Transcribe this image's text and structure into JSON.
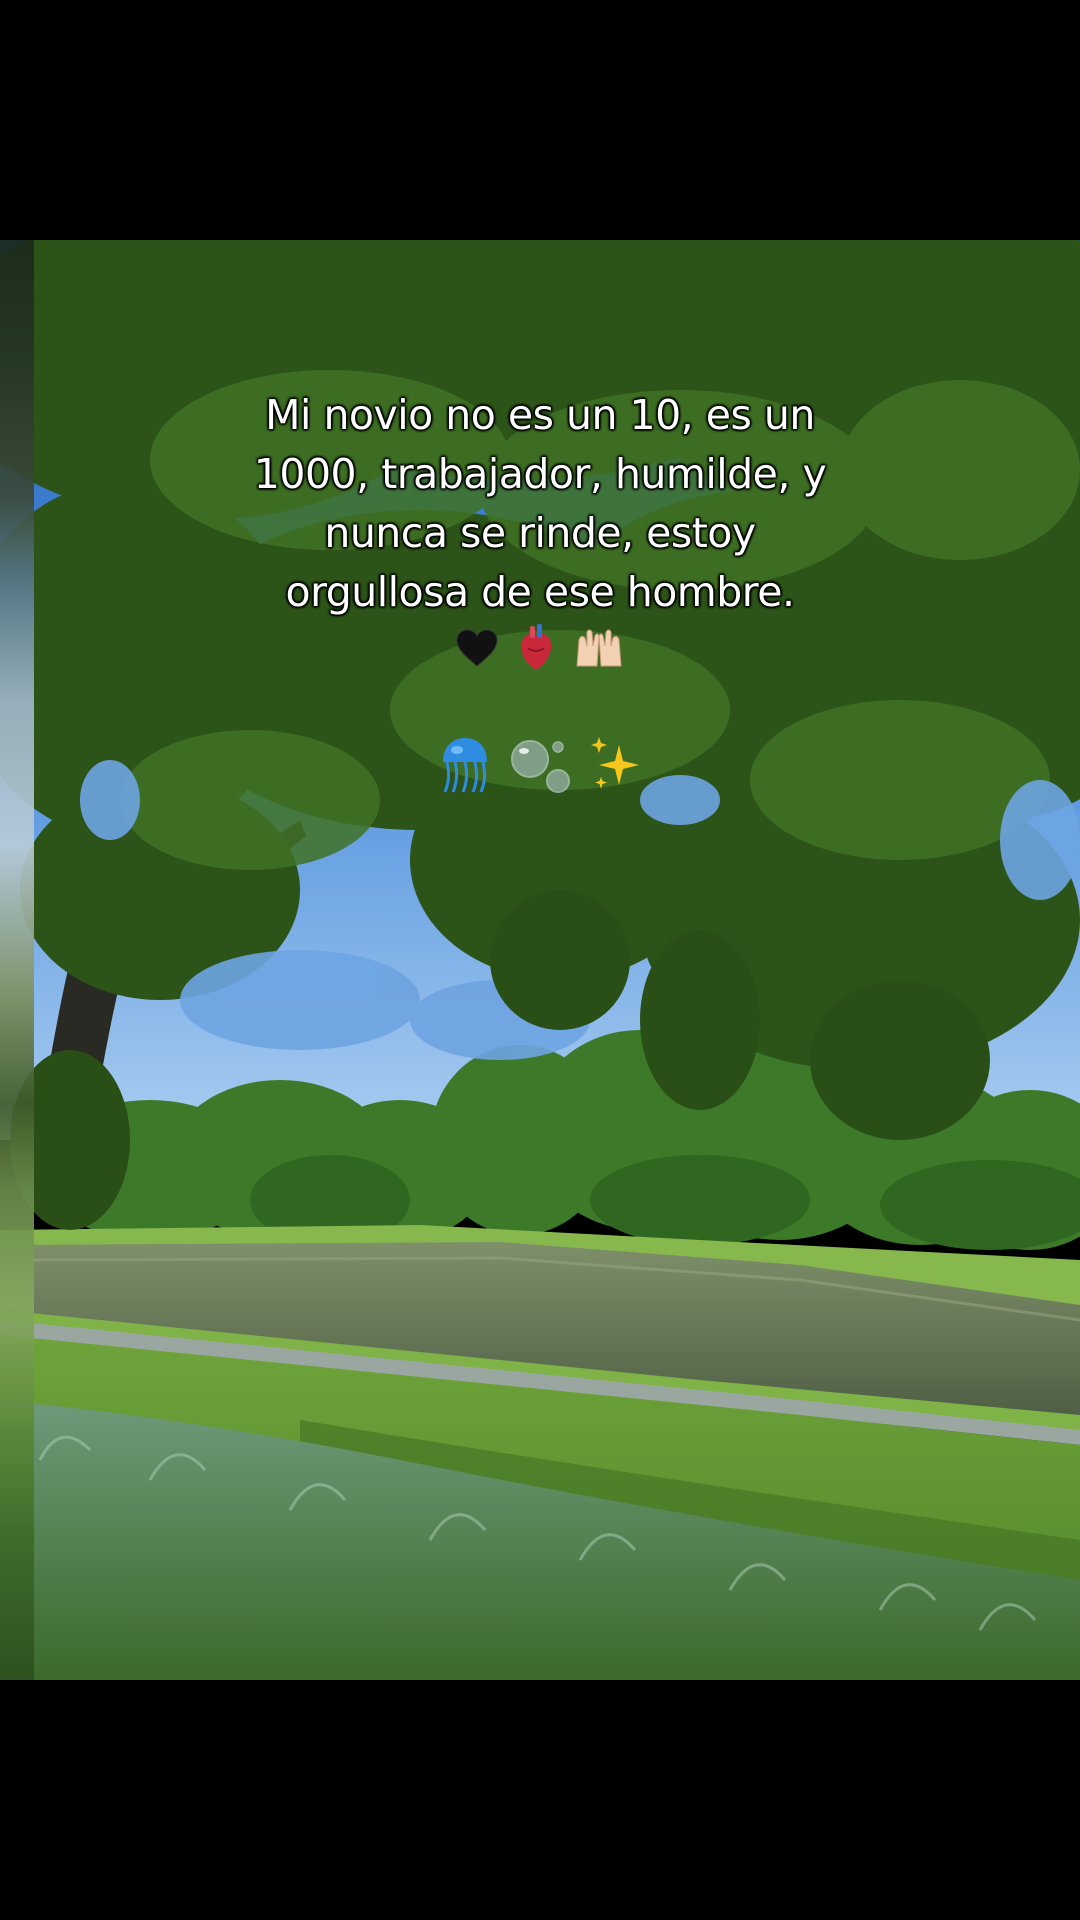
{
  "caption": {
    "lines": [
      "Mi novio no es un 10, es un",
      "1000, trabajador, humilde, y",
      "nunca se rinde, estoy",
      "orgullosa de ese hombre."
    ]
  },
  "emoji_row_1": [
    "black-heart",
    "anatomical-heart",
    "raising-hands"
  ],
  "emoji_row_2": [
    "jellyfish",
    "bubbles",
    "sparkles"
  ],
  "colors": {
    "background": "#000000",
    "sky": "#3f7fd0",
    "foliage": "#2f5a1e",
    "grass": "#7fb347",
    "water": "#5f6e52",
    "caption_text": "#ffffff"
  }
}
